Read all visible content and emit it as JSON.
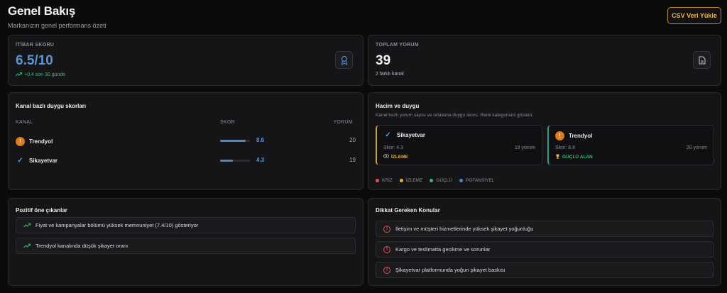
{
  "header": {
    "title": "Genel Bakış",
    "subtitle": "Markanızın genel performans özeti",
    "csv_button": "CSV Veri Yükle"
  },
  "stats": {
    "reputation": {
      "label": "İTİBAR SKORU",
      "value": "6.5/10",
      "note": "+0.4 son 30 günde",
      "icon": "award-icon"
    },
    "reviews": {
      "label": "TOPLAM YORUM",
      "value": "39",
      "note": "2 farklı kanal",
      "icon": "document-icon"
    }
  },
  "channel_scores": {
    "title": "Kanal bazlı duygu skorları",
    "headers": {
      "channel": "KANAL",
      "score": "SKOR",
      "reviews": "YORUM"
    },
    "rows": [
      {
        "name": "Trendyol",
        "icon": "warning-icon",
        "score": "8.6",
        "score_value": 8.6,
        "count": "20"
      },
      {
        "name": "Sikayetvar",
        "icon": "check-icon",
        "score": "4.3",
        "score_value": 4.3,
        "count": "19"
      }
    ]
  },
  "volume": {
    "title": "Hacim ve duygu",
    "description": "Kanal bazlı yorum sayısı ve ortalama duygu skoru. Renk kategorisini gösterir.",
    "cards": [
      {
        "name": "Sikayetvar",
        "icon": "check-icon",
        "score_label": "Skor:",
        "score": "4.3",
        "count": "19 yorum",
        "tag": "İZLEME",
        "tag_color": "#e3b341",
        "border_color": "#c9a227"
      },
      {
        "name": "Trendyol",
        "icon": "warning-icon",
        "score_label": "Skor:",
        "score": "8.6",
        "count": "20 yorum",
        "tag": "GÜÇLÜ ALAN",
        "tag_color": "#3fb877",
        "border_color": "#2f9e8f"
      }
    ],
    "legend": [
      {
        "label": "KRİZ",
        "color": "#e2524f"
      },
      {
        "label": "İZLEME",
        "color": "#e3b341"
      },
      {
        "label": "GÜÇLÜ",
        "color": "#3fb877"
      },
      {
        "label": "POTANSİYEL",
        "color": "#4e86c6"
      }
    ]
  },
  "positives": {
    "title": "Pozitif öne çıkanlar",
    "items": [
      "Fiyat ve kampanyalar bölümü yüksek memnuniyet (7.4/10) gösteriyor",
      "Trendyol kanalında düşük şikayet oranı"
    ]
  },
  "attention": {
    "title": "Dikkat Gereken Konular",
    "items": [
      "İletişim ve müşteri hizmetlerinde yüksek şikayet yoğunluğu",
      "Kargo ve teslimatta gecikme ve sorunlar",
      "Şikayetvar platformunda yoğun şikayet baskısı"
    ]
  },
  "colors": {
    "accent_blue": "#5b95d8",
    "positive": "#3fb877",
    "warning": "#e2524f",
    "brand_gold": "#e9b556"
  }
}
